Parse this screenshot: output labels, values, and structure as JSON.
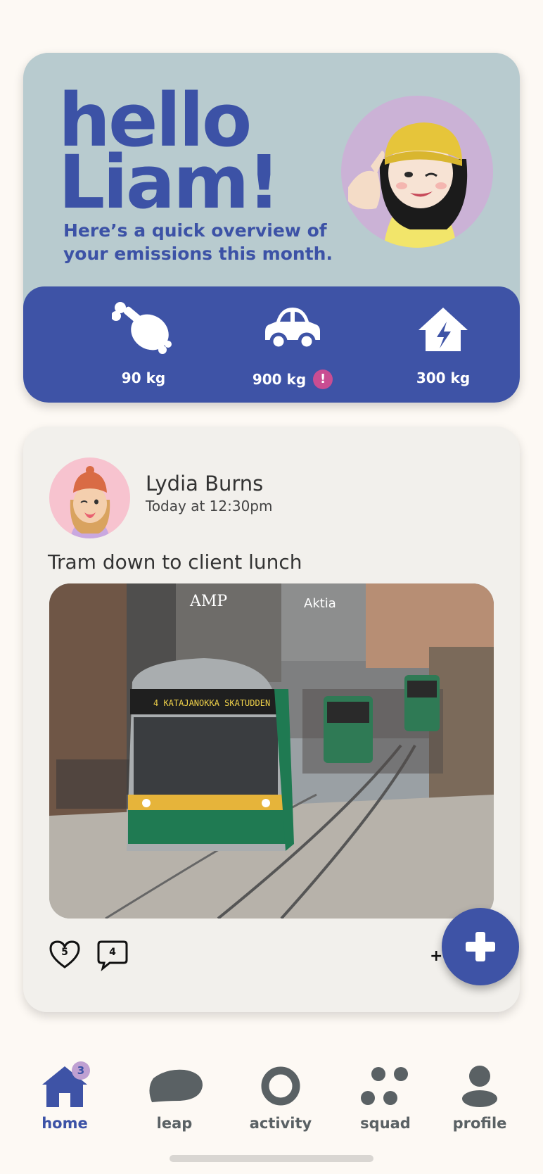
{
  "greeting": {
    "line1": "hello",
    "line2": "Liam!",
    "subtitle": "Here’s a quick overview of your emissions this month."
  },
  "emissions": [
    {
      "icon": "drumstick-icon",
      "value": "90 kg"
    },
    {
      "icon": "car-icon",
      "value": "900 kg",
      "alert": "!"
    },
    {
      "icon": "house-bolt-icon",
      "value": "300 kg"
    }
  ],
  "post": {
    "author": "Lydia Burns",
    "time": "Today at 12:30pm",
    "caption": "Tram down to client lunch",
    "photo": {
      "tram_sign": "4 KATAJANOKKA SKATUDDEN",
      "building_sign": "Aktia",
      "store_sign": "AMP"
    },
    "likes": "5",
    "comments": "4",
    "plus": "+"
  },
  "nav": {
    "items": [
      {
        "label": "home",
        "badge": "3",
        "active": true
      },
      {
        "label": "leap"
      },
      {
        "label": "activity"
      },
      {
        "label": "squad"
      },
      {
        "label": "profile"
      }
    ]
  },
  "colors": {
    "brand_blue": "#3e53a6",
    "hero_bg": "#b8cbcf",
    "alert_pink": "#c94d92",
    "nav_grey": "#5a6164"
  }
}
